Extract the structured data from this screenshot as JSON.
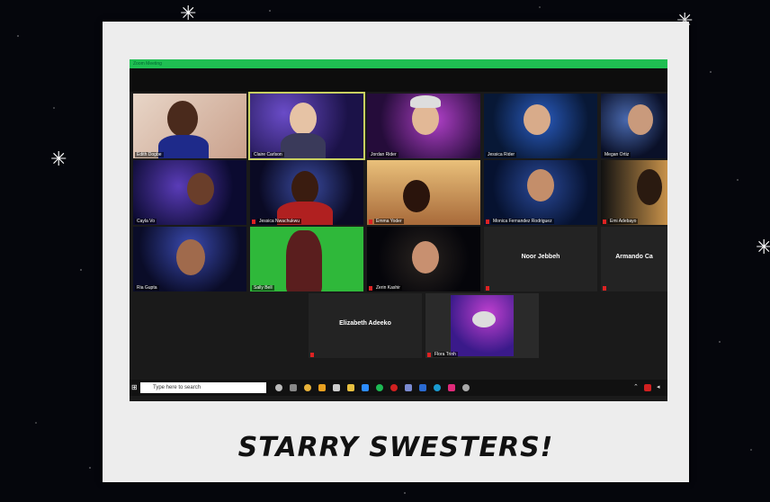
{
  "window": {
    "title": "Zoom Meeting"
  },
  "caption": "STARRY SWESTERS!",
  "taskbar": {
    "search_placeholder": "Type here to search"
  },
  "participants": [
    "Edith Dogbe",
    "Claire Carlson",
    "Jordan Rider",
    "Jessica Rider",
    "Megan Ortiz",
    "Cayla Vo",
    "Jessica Nwachukwu",
    "Emma Yoder",
    "Monica Fernandez Rodriguez",
    "Emi Adebayo",
    "Ria Gupta",
    "Sally Bell",
    "Zerin Kashir",
    "Noor Jebbeh",
    "Armando Ca",
    "Elizabeth Adeeko",
    "Flora Trinh"
  ],
  "camera_off_labels": {
    "noor": "Noor Jebbeh",
    "armando": "Armando Ca",
    "elizabeth": "Elizabeth Adeeko"
  },
  "colors": {
    "zoom_bar": "#1fbf52",
    "active_speaker": "#c8d060"
  }
}
